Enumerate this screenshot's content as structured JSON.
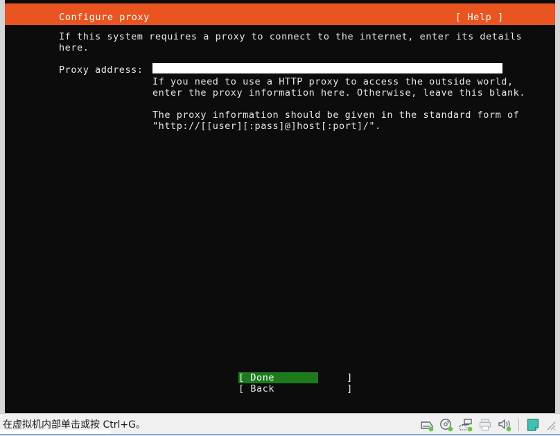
{
  "window": {
    "kind": "vmware-guest-console"
  },
  "installer": {
    "header": {
      "title": "Configure proxy",
      "help_label": "[ Help ]"
    },
    "intro_text": "If this system requires a proxy to connect to the internet, enter its details\nhere.",
    "field": {
      "label": "Proxy address:",
      "value": "",
      "placeholder": ""
    },
    "help_paragraph_1": "If you need to use a HTTP proxy to access the outside world,\nenter the proxy information here. Otherwise, leave this blank.",
    "help_paragraph_2": "The proxy information should be given in the standard form of\n\"http://[[user][:pass]@]host[:port]/\".",
    "buttons": [
      {
        "label": "[ Done            ]",
        "name": "done",
        "selected": true
      },
      {
        "label": "[ Back            ]",
        "name": "back",
        "selected": false
      }
    ],
    "colors": {
      "header_background": "#e95420",
      "screen_background": "#0c0c0c",
      "foreground": "#e6e6e6",
      "selection_background": "#1d7a1d",
      "input_background": "#ffffff"
    }
  },
  "status_bar": {
    "message": "在虚拟机内部单击或按 Ctrl+G。",
    "icons": [
      {
        "name": "hard-disk-icon",
        "title": "hard disk"
      },
      {
        "name": "cd-dvd-icon",
        "title": "cd dvd drive"
      },
      {
        "name": "network-adapter-icon",
        "title": "network adapter"
      },
      {
        "name": "printer-icon",
        "title": "printer"
      },
      {
        "name": "sound-card-icon",
        "title": "sound card"
      },
      {
        "name": "usb-device-icon",
        "title": "usb device"
      }
    ]
  }
}
